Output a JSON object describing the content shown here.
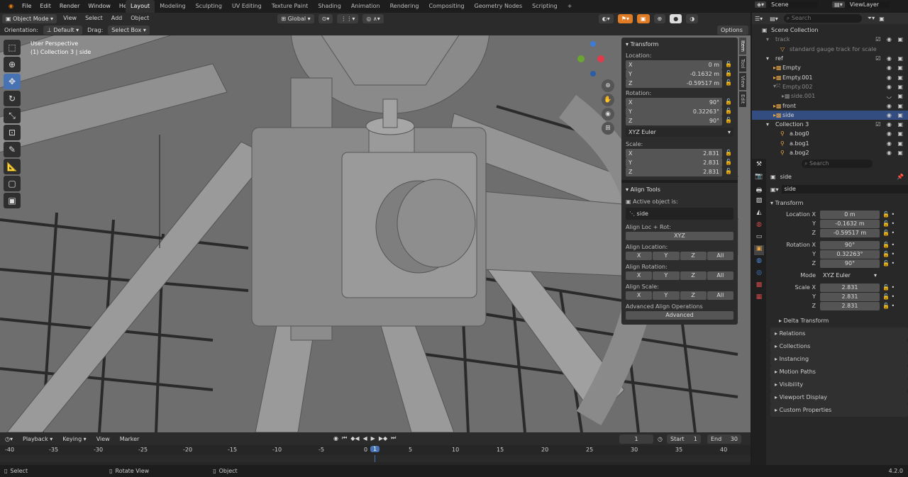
{
  "menu": [
    "File",
    "Edit",
    "Render",
    "Window",
    "Help"
  ],
  "workspaces": [
    "Layout",
    "Modeling",
    "Sculpting",
    "UV Editing",
    "Texture Paint",
    "Shading",
    "Animation",
    "Rendering",
    "Compositing",
    "Geometry Nodes",
    "Scripting",
    "+"
  ],
  "scene": "Scene",
  "viewlayer": "ViewLayer",
  "vp": {
    "mode": "Object Mode",
    "menus": [
      "View",
      "Select",
      "Add",
      "Object"
    ],
    "transform": "Global",
    "orientation_label": "Orientation:",
    "orientation": "Default",
    "drag_label": "Drag:",
    "drag": "Select Box",
    "options": "Options",
    "perspective": "User Perspective",
    "collection": "(1) Collection 3 | side"
  },
  "npanel": {
    "transform_title": "Transform",
    "location_label": "Location:",
    "loc": [
      {
        "a": "X",
        "v": "0 m"
      },
      {
        "a": "Y",
        "v": "-0.1632 m"
      },
      {
        "a": "Z",
        "v": "-0.59517 m"
      }
    ],
    "rotation_label": "Rotation:",
    "rot": [
      {
        "a": "X",
        "v": "90°"
      },
      {
        "a": "Y",
        "v": "0.32263°"
      },
      {
        "a": "Z",
        "v": "90°"
      }
    ],
    "euler": "XYZ Euler",
    "scale_label": "Scale:",
    "scale": [
      {
        "a": "X",
        "v": "2.831"
      },
      {
        "a": "Y",
        "v": "2.831"
      },
      {
        "a": "Z",
        "v": "2.831"
      }
    ],
    "align_title": "Align Tools",
    "active_label": "Active object is:",
    "active_obj": "side",
    "loc_rot": "Align Loc + Rot:",
    "xyz": "XYZ",
    "align_loc": "Align Location:",
    "align_rot": "Align Rotation:",
    "align_scale": "Align Scale:",
    "axes": [
      "X",
      "Y",
      "Z",
      "All"
    ],
    "adv_label": "Advanced Align Operations",
    "adv_btn": "Advanced",
    "tabs": [
      "Item",
      "Tool",
      "View",
      "Edit"
    ]
  },
  "timeline": {
    "menus": [
      "Playback",
      "Keying",
      "View",
      "Marker"
    ],
    "frame": "1",
    "start_label": "Start",
    "start": "1",
    "end_label": "End",
    "end": "30",
    "ticks": [
      "-40",
      "-35",
      "-30",
      "-25",
      "-20",
      "-15",
      "-10",
      "-5",
      "0",
      "1",
      "5",
      "10",
      "15",
      "20",
      "25",
      "30",
      "35",
      "40"
    ]
  },
  "status": {
    "select": "Select",
    "rotate": "Rotate View",
    "object": "Object",
    "version": "4.2.0"
  },
  "outliner": {
    "search": "Search",
    "items": [
      {
        "name": "Scene Collection",
        "indent": 0
      },
      {
        "name": "track",
        "indent": 1
      },
      {
        "name": "standard gauge track for scale",
        "indent": 2
      },
      {
        "name": "ref",
        "indent": 1
      },
      {
        "name": "Empty",
        "indent": 2
      },
      {
        "name": "Empty.001",
        "indent": 2
      },
      {
        "name": "Empty.002",
        "indent": 2
      },
      {
        "name": "side.001",
        "indent": 3
      },
      {
        "name": "front",
        "indent": 2
      },
      {
        "name": "side",
        "indent": 2
      },
      {
        "name": "Collection 3",
        "indent": 1
      },
      {
        "name": "a.bog0",
        "indent": 2
      },
      {
        "name": "a.bog1",
        "indent": 2
      },
      {
        "name": "a.bog2",
        "indent": 2
      }
    ]
  },
  "props": {
    "search": "Search",
    "object": "side",
    "datablock": "side",
    "transform": "Transform",
    "loc": [
      {
        "l": "Location X",
        "v": "0 m"
      },
      {
        "l": "Y",
        "v": "-0.1632 m"
      },
      {
        "l": "Z",
        "v": "-0.59517 m"
      }
    ],
    "rot": [
      {
        "l": "Rotation X",
        "v": "90°"
      },
      {
        "l": "Y",
        "v": "0.32263°"
      },
      {
        "l": "Z",
        "v": "90°"
      }
    ],
    "mode_label": "Mode",
    "mode": "XYZ Euler",
    "scale": [
      {
        "l": "Scale X",
        "v": "2.831"
      },
      {
        "l": "Y",
        "v": "2.831"
      },
      {
        "l": "Z",
        "v": "2.831"
      }
    ],
    "sections": [
      "Delta Transform",
      "Relations",
      "Collections",
      "Instancing",
      "Motion Paths",
      "Visibility",
      "Viewport Display",
      "Custom Properties"
    ]
  }
}
